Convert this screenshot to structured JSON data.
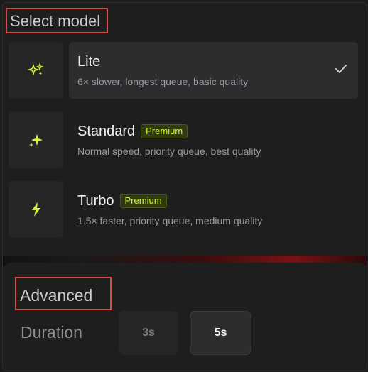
{
  "select_model": {
    "title": "Select model",
    "models": [
      {
        "name": "Lite",
        "description": "6× slower, longest queue, basic quality",
        "selected": true,
        "premium": false,
        "icon": "sparkle-small-icon"
      },
      {
        "name": "Standard",
        "badge": "Premium",
        "description": "Normal speed, priority queue, best quality",
        "selected": false,
        "premium": true,
        "icon": "sparkle-icon"
      },
      {
        "name": "Turbo",
        "badge": "Premium",
        "description": "1.5× faster, priority queue, medium quality",
        "selected": false,
        "premium": true,
        "icon": "lightning-icon"
      }
    ]
  },
  "advanced": {
    "title": "Advanced",
    "duration_label": "Duration",
    "duration_options": [
      "3s",
      "5s"
    ],
    "selected_duration": "5s"
  },
  "colors": {
    "accent": "#d6f23a",
    "highlight_box": "#e04848"
  }
}
